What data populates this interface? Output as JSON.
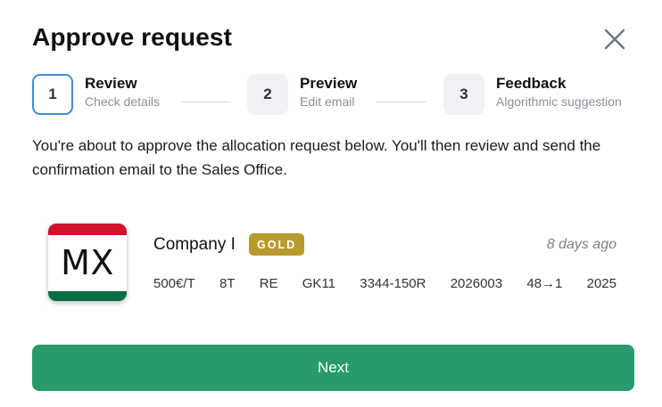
{
  "dialog": {
    "title": "Approve request",
    "close_icon": "close-icon"
  },
  "steps": [
    {
      "number": "1",
      "title": "Review",
      "subtitle": "Check details",
      "active": true
    },
    {
      "number": "2",
      "title": "Preview",
      "subtitle": "Edit email",
      "active": false
    },
    {
      "number": "3",
      "title": "Feedback",
      "subtitle": "Algorithmic suggestion",
      "active": false
    }
  ],
  "description": "You're about to approve the allocation request below. You'll then review and send the confirmation email to the Sales Office.",
  "request": {
    "country_code": "MX",
    "flag_colors": {
      "top": "#d0122f",
      "bottom": "#0b6b44"
    },
    "company": "Company I",
    "tier": "GOLD",
    "tier_color": "#b89a2e",
    "time_ago": "8 days ago",
    "details": [
      "500€/T",
      "8T",
      "RE",
      "GK11",
      "3344-150R",
      "2026003",
      "48→1",
      "2025"
    ]
  },
  "actions": {
    "next_label": "Next",
    "next_color": "#299a6a"
  }
}
